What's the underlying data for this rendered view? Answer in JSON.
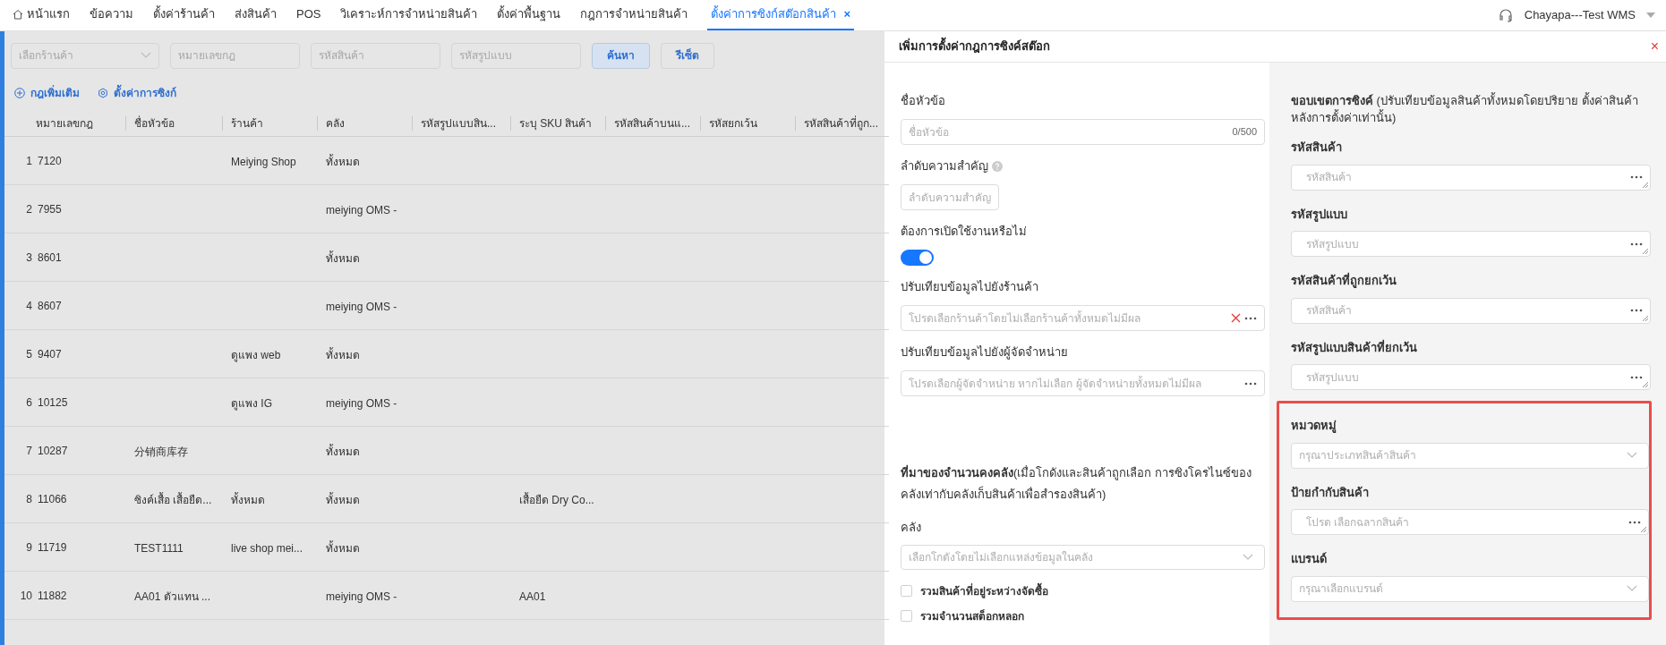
{
  "nav": {
    "tabs": [
      {
        "label": "หน้าแรก",
        "kind": "home",
        "selected": false
      },
      {
        "label": "ข้อความ",
        "selected": false
      },
      {
        "label": "ตั้งค่าร้านค้า",
        "selected": false
      },
      {
        "label": "ส่งสินค้า",
        "selected": false
      },
      {
        "label": "POS",
        "selected": false
      },
      {
        "label": "วิเคราะห์การจำหน่ายสินค้า",
        "selected": false
      },
      {
        "label": "ตั้งค่าพื้นฐาน",
        "selected": false
      },
      {
        "label": "กฎการจำหน่ายสินค้า",
        "selected": false
      },
      {
        "label": "ตั้งค่าการซิงก์สต๊อกสินค้า",
        "selected": true,
        "close": "×"
      }
    ],
    "user": "Chayapa---Test WMS"
  },
  "filters": {
    "fields": [
      {
        "kind": "select",
        "placeholder": "เลือกร้านค้า"
      },
      {
        "kind": "input",
        "placeholder": "หมายเลขกฎ"
      },
      {
        "kind": "input",
        "placeholder": "รหัสสินค้า"
      },
      {
        "kind": "input",
        "placeholder": "รหัสรูปแบบ"
      }
    ],
    "buttons": [
      {
        "label": "ค้นหา",
        "primary": true
      },
      {
        "label": "รีเซ็ต",
        "primary": false
      }
    ]
  },
  "actions": [
    {
      "label": "กฎเพิ่มเติม",
      "kind": "add"
    },
    {
      "label": "ตั้งค่าการซิงก์",
      "kind": "settings"
    }
  ],
  "table": {
    "columns": [
      "หมายเลขกฎ",
      "ชื่อหัวข้อ",
      "ร้านค้า",
      "คลัง",
      "รหัสรูปแบบสิน...",
      "ระบุ SKU สินค้า",
      "รหัสสินค้าบนแ...",
      "รหัสยกเว้น",
      "รหัสสินค้าที่ถูก..."
    ],
    "rows": [
      {
        "index": "1",
        "rule_no": "7120",
        "shop": "Meiying Shop",
        "warehouse": "ทั้งหมด"
      },
      {
        "index": "2",
        "rule_no": "7955",
        "warehouse": "meiying OMS -"
      },
      {
        "index": "3",
        "rule_no": "8601",
        "warehouse": "ทั้งหมด"
      },
      {
        "index": "4",
        "rule_no": "8607",
        "warehouse": "meiying OMS -"
      },
      {
        "index": "5",
        "rule_no": "9407",
        "shop": "ดูแพง web",
        "warehouse": "ทั้งหมด"
      },
      {
        "index": "6",
        "rule_no": "10125",
        "shop": "ดูแพง IG",
        "warehouse": "meiying OMS -"
      },
      {
        "index": "7",
        "rule_no": "10287",
        "title": "分销商库存",
        "warehouse": "ทั้งหมด"
      },
      {
        "index": "8",
        "rule_no": "11066",
        "title": "ซิงค์เสื้อ เสื้อยืด...",
        "shop": "ทั้งหมด",
        "warehouse": "ทั้งหมด",
        "sku": "เสื้อยืด Dry Co..."
      },
      {
        "index": "9",
        "rule_no": "11719",
        "title": "TEST1111",
        "shop": "live shop mei...",
        "warehouse": "ทั้งหมด"
      },
      {
        "index": "10",
        "rule_no": "11882",
        "title": "AA01 ตัวแทน ...",
        "warehouse": "meiying OMS -",
        "sku": "AA01"
      }
    ]
  },
  "drawer": {
    "title": "เพิ่มการตั้งค่ากฎการซิงค์สต๊อก",
    "close": "×",
    "left_fields": [
      {
        "kind": "text",
        "label": "ชื่อหัวข้อ",
        "placeholder": "ชื่อหัวข้อ",
        "counter": "0/500"
      },
      {
        "kind": "short",
        "label": "ลำดับความสำคัญ",
        "placeholder": "ลำดับความสำคัญ",
        "help": true
      },
      {
        "kind": "switch",
        "label": "ต้องการเปิดใช้งานหรือไม่",
        "on": true
      },
      {
        "kind": "picker",
        "label": "ปรับเทียบข้อมูลไปยังร้านค้า",
        "placeholder": "โปรดเลือกร้านค้าโดยไม่เลือกร้านค้าทั้งหมดไม่มีผล",
        "clearable": true
      },
      {
        "kind": "picker",
        "label": "ปรับเทียบข้อมูลไปยังผู้จัดจำหน่าย",
        "placeholder": "โปรดเลือกผู้จัดจำหน่าย หากไม่เลือก ผู้จัดจำหน่ายทั้งหมดไม่มีผล",
        "clearable": false
      }
    ],
    "stock_section": {
      "heading": "**ที่มาของจำนวนคงคลัง**(เมื่อโกดังและสินค้าถูกเลือก การซิงโครไนซ์ของคลังเท่ากับคลังเก็บสินค้าเพื่อสำรองสินค้า)",
      "select": {
        "label": "คลัง",
        "placeholder": "เลือกโกดังโดยไม่เลือกแหล่งข้อมูลในคลัง"
      },
      "checkboxes": [
        {
          "label": "รวมสินค้าที่อยู่ระหว่างจัดซื้อ",
          "checked": false
        },
        {
          "label": "รวมจำนวนสต็อกหลอก",
          "checked": false
        }
      ]
    },
    "scope": {
      "heading": "**ขอบเขตการซิงค์** (ปรับเทียบข้อมูลสินค้าทั้งหมดโดยปริยาย ตั้งค่าสินค้าหลังการตั้งค่าเท่านั้น)",
      "fields": [
        {
          "kind": "textarea",
          "label": "รหัสสินค้า",
          "placeholder": "รหัสสินค้า"
        },
        {
          "kind": "textarea",
          "label": "รหัสรูปแบบ",
          "placeholder": "รหัสรูปแบบ"
        },
        {
          "kind": "textarea",
          "label": "รหัสสินค้าที่ถูกยกเว้น",
          "placeholder": "รหัสสินค้า"
        },
        {
          "kind": "textarea",
          "label": "รหัสรูปแบบสินค้าที่ยกเว้น",
          "placeholder": "รหัสรูปแบบ"
        }
      ],
      "highlighted_fields": [
        {
          "kind": "select",
          "label": "หมวดหมู่",
          "placeholder": "กรุณาประเภทสินค้าสินค้า"
        },
        {
          "kind": "textarea",
          "label": "ป้ายกำกับสินค้า",
          "placeholder": "โปรด เลือกฉลากสินค้า"
        },
        {
          "kind": "select",
          "label": "แบรนด์",
          "placeholder": "กรุณาเลือกแบรนด์"
        }
      ]
    }
  }
}
